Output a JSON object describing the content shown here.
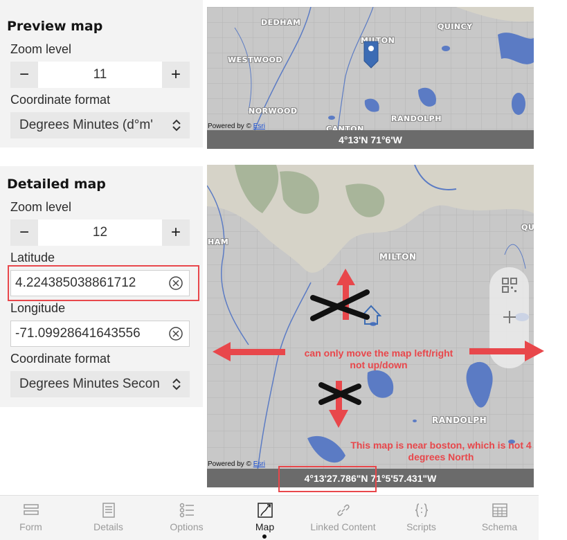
{
  "preview": {
    "title": "Preview map",
    "zoom_label": "Zoom level",
    "zoom_value": "11",
    "format_label": "Coordinate format",
    "format_value": "Degrees Minutes (d°m'",
    "map": {
      "places": [
        "DEDHAM",
        "QUINCY",
        "MILTON",
        "WESTWOOD",
        "NORWOOD",
        "RANDOLPH",
        "CANTON"
      ],
      "powered_prefix": "Powered by © ",
      "powered_link": "Esri",
      "coords": "4°13'N 71°6'W"
    }
  },
  "detailed": {
    "title": "Detailed map",
    "zoom_label": "Zoom level",
    "zoom_value": "12",
    "lat_label": "Latitude",
    "lat_value": "4.224385038861712",
    "lon_label": "Longitude",
    "lon_value": "-71.09928641643556",
    "format_label": "Coordinate format",
    "format_value": "Degrees Minutes Secon",
    "map": {
      "places": [
        "HAM",
        "MILTON",
        "RANDOLPH",
        "QU"
      ],
      "powered_prefix": "Powered by © ",
      "powered_link": "Esri",
      "coords": "4°13'27.786\"N 71°5'57.431\"W"
    }
  },
  "annotations": {
    "move_note_line1": "can only move the map left/right",
    "move_note_line2": "not up/down",
    "boston_note_line1": "This map is near boston, which is not 4",
    "boston_note_line2": "degrees North"
  },
  "tabs": [
    {
      "label": "Form",
      "icon": "form-icon"
    },
    {
      "label": "Details",
      "icon": "details-icon"
    },
    {
      "label": "Options",
      "icon": "options-icon"
    },
    {
      "label": "Map",
      "icon": "map-icon",
      "active": true
    },
    {
      "label": "Linked Content",
      "icon": "link-icon"
    },
    {
      "label": "Scripts",
      "icon": "scripts-icon"
    },
    {
      "label": "Schema",
      "icon": "schema-icon"
    }
  ],
  "colors": {
    "annotation_red": "#e8474b",
    "water": "#5b7bc4",
    "land": "#c8c8c8",
    "park": "#a8b59a",
    "coord_bar": "#6b6b6b"
  }
}
